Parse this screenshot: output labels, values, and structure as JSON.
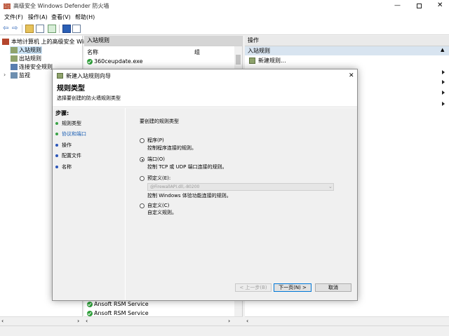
{
  "window": {
    "title": "高级安全 Windows Defender 防火墙"
  },
  "menu": [
    "文件(F)",
    "操作(A)",
    "查看(V)",
    "帮助(H)"
  ],
  "tree": {
    "root": "本地计算机 上的高级安全 Win",
    "items": [
      "入站规则",
      "出站规则",
      "连接安全规则",
      "监视"
    ]
  },
  "list": {
    "header": "入站规则",
    "col_name": "名称",
    "col_group": "组",
    "top_rows": [
      "360ceupdate.exe"
    ],
    "bottom_rows": [
      "Ansoft RSM Service",
      "Ansoft RSM Service"
    ]
  },
  "actions": {
    "header": "操作",
    "section": "入站规则",
    "items": [
      "新建规则..."
    ]
  },
  "dialog": {
    "title": "新建入站规则向导",
    "heading": "规则类型",
    "subheading": "选择要创建的防火墙规则类型",
    "steps_label": "步骤:",
    "steps": [
      "规则类型",
      "协议和端口",
      "操作",
      "配置文件",
      "名称"
    ],
    "question": "要创建的规则类型",
    "options": [
      {
        "label": "程序(P)",
        "desc": "控制程序连接的规则。"
      },
      {
        "label": "端口(O)",
        "desc": "控制 TCP 或 UDP 端口连接的规则。"
      },
      {
        "label": "预定义(E):",
        "desc": "控制 Windows 体验功能连接的规则。"
      },
      {
        "label": "自定义(C)",
        "desc": "自定义规则。"
      }
    ],
    "predefined_value": "@FirewallAPI.dll,-80200",
    "selected_option": 1,
    "buttons": {
      "back": "< 上一步(B)",
      "next": "下一页(N) >",
      "cancel": "取消"
    }
  },
  "colors": {
    "step_active": "#3aa346",
    "step_pending": "#2b55b8",
    "link": "#1a5fb4"
  }
}
